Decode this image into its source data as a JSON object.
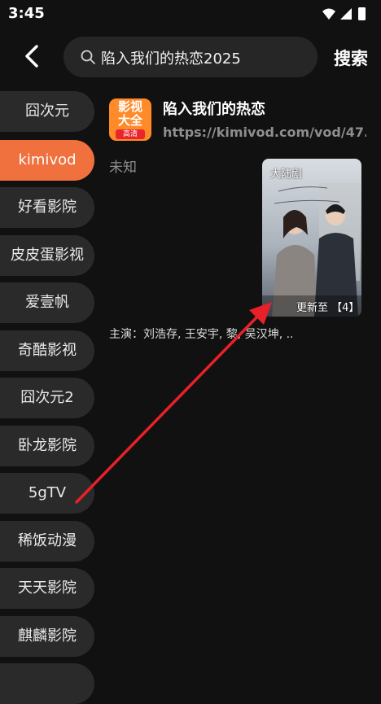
{
  "status_bar": {
    "time": "3:45",
    "icons": [
      "wifi-icon",
      "signal-icon",
      "battery-icon"
    ]
  },
  "header": {
    "back_icon": "chevron-left-icon",
    "search_query": "陷入我们的热恋2025",
    "search_button": "搜索"
  },
  "sidebar": {
    "items": [
      {
        "label": "囧次元",
        "active": false
      },
      {
        "label": "kimivod",
        "active": true
      },
      {
        "label": "好看影院",
        "active": false
      },
      {
        "label": "皮皮蛋影视",
        "active": false
      },
      {
        "label": "爱壹帆",
        "active": false
      },
      {
        "label": "奇酷影视",
        "active": false
      },
      {
        "label": "囧次元2",
        "active": false
      },
      {
        "label": "卧龙影院",
        "active": false
      },
      {
        "label": "5gTV",
        "active": false
      },
      {
        "label": "稀饭动漫",
        "active": false
      },
      {
        "label": "天天影院",
        "active": false
      },
      {
        "label": "麒麟影院",
        "active": false
      }
    ]
  },
  "result": {
    "source_logo": {
      "line1": "影视",
      "line2": "大全",
      "badge": "高清"
    },
    "title": "陷入我们的热恋",
    "url": "https://kimivod.com/vod/47...",
    "status": "未知",
    "poster": {
      "tag": "大陆剧",
      "update": "更新至 【4】"
    },
    "cast": "主演：刘浩存, 王安宇, 黎, 吴汉坤, .."
  },
  "colors": {
    "accent": "#f0703e",
    "background": "#111111",
    "annotation_arrow": "#e8202a"
  }
}
